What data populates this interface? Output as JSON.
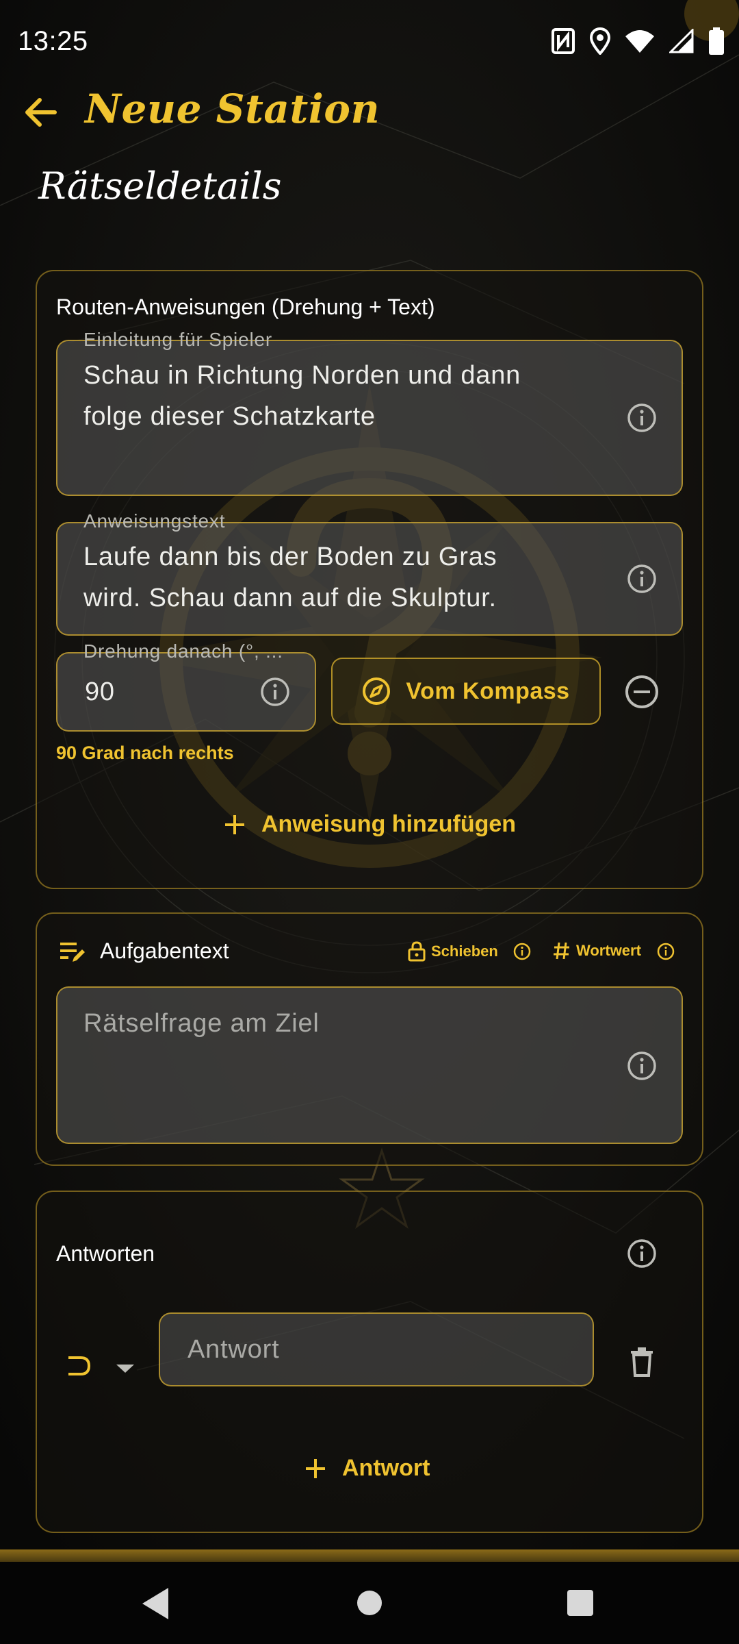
{
  "status_bar": {
    "time": "13:25",
    "icons": [
      "nfc-icon",
      "location-icon",
      "wifi-icon",
      "signal-icon",
      "battery-icon"
    ]
  },
  "header": {
    "title": "Neue Station",
    "back_icon": "arrow-left-icon"
  },
  "section_title": "Rätseldetails",
  "route_card": {
    "heading": "Routen-Anweisungen (Drehung + Text)",
    "intro": {
      "label": "Einleitung für Spieler",
      "value_line1": "Schau in Richtung Norden und dann",
      "value_line2": "folge dieser Schatzkarte"
    },
    "instruction": {
      "label": "Anweisungstext",
      "value_line1": "Laufe dann bis der Boden zu Gras",
      "value_line2": "wird. Schau dann auf die Skulptur."
    },
    "rotation": {
      "label": "Drehung danach (°, ...",
      "value": "90"
    },
    "compass_button": "Vom Kompass",
    "rotation_hint": "90 Grad nach rechts",
    "add_instruction": "Anweisung hinzufügen"
  },
  "task_card": {
    "heading": "Aufgabentext",
    "chip_shift": "Schieben",
    "chip_wordvalue": "Wortwert",
    "placeholder": "Rätselfrage am Ziel"
  },
  "answers_card": {
    "heading": "Antworten",
    "answer_placeholder": "Antwort",
    "add_answer": "Antwort"
  },
  "colors": {
    "accent": "#f0c330",
    "background": "#0f0f0e",
    "field": "#5a5a5a"
  }
}
